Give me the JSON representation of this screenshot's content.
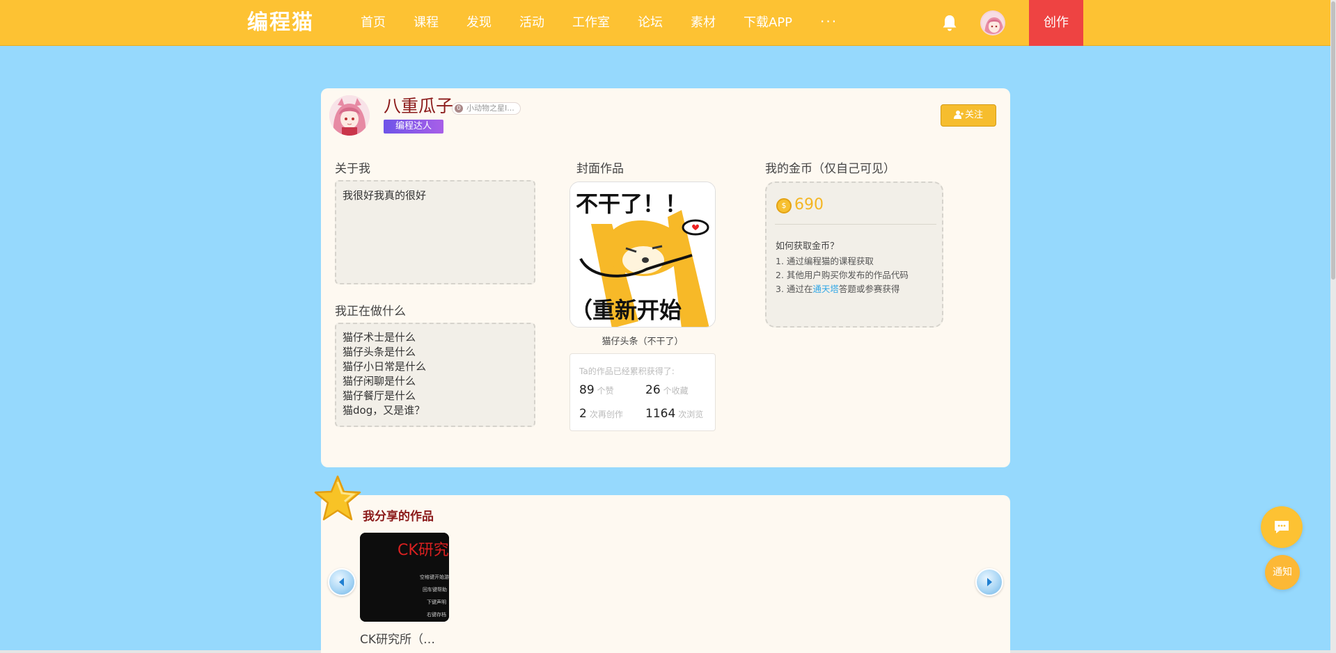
{
  "header": {
    "logo": "编程猫",
    "nav": [
      {
        "label": "首页"
      },
      {
        "label": "课程"
      },
      {
        "label": "发现"
      },
      {
        "label": "活动"
      },
      {
        "label": "工作室"
      },
      {
        "label": "论坛"
      },
      {
        "label": "素材"
      },
      {
        "label": "下载APP"
      }
    ],
    "more": "···",
    "create_label": "创作"
  },
  "profile": {
    "username": "八重瓜子",
    "star_badge_icon": "0",
    "star_badge": "小动物之星I...",
    "pro_badge": "编程达人",
    "follow_label": "关注",
    "about": {
      "title": "关于我",
      "text": "我很好我真的很好"
    },
    "doing": {
      "title": "我正在做什么",
      "lines": [
        "猫仔术士是什么",
        "猫仔头条是什么",
        "猫仔小日常是什么",
        "猫仔闲聊是什么",
        "猫仔餐厅是什么",
        "猫dog，又是谁？"
      ]
    },
    "cover": {
      "title": "封面作品",
      "image_text_top": "不干了！！",
      "image_text_bottom": "（重新开始",
      "caption": "猫仔头条（不干了）",
      "stats_head": "Ta的作品已经累积获得了:",
      "likes": "89",
      "likes_unit": "个赞",
      "favorites": "26",
      "favorites_unit": "个收藏",
      "remixes": "2",
      "remixes_unit": "次再创作",
      "views": "1164",
      "views_unit": "次浏览"
    },
    "coins": {
      "title": "我的金币（仅自己可见）",
      "coin_symbol": "$",
      "amount": "690",
      "how_title": "如何获取金币？",
      "item1": "1. 通过编程猫的课程获取",
      "item2": "2. 其他用户购买你发布的作品代码",
      "item3_prefix": "3. 通过在",
      "item3_link": "通天塔",
      "item3_suffix": "答题或参赛获得"
    }
  },
  "works": {
    "title": "我分享的作品",
    "items": [
      {
        "name": "CK研究所（…",
        "thumb_title": "CK研究",
        "thumb_lines": [
          "空格键开始游",
          "回车键帮助",
          "下键声明",
          "右键存档"
        ]
      }
    ]
  },
  "float": {
    "notify_label": "通知"
  },
  "colors": {
    "header_bg": "#fdc233",
    "page_bg": "#96d9fd",
    "create_bg": "#ee4342",
    "username": "#8b1a1a",
    "coin": "#f4b623",
    "link": "#2fa6e6"
  }
}
